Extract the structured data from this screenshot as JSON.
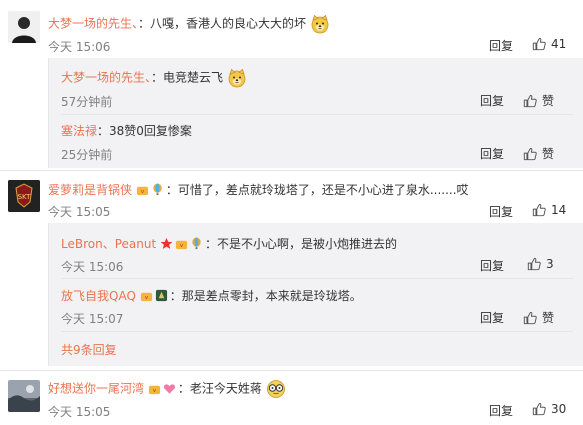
{
  "comments": [
    {
      "user": "大梦一场的先生、",
      "text": "：八嘎，香港人的良心大大的坏",
      "emoji": "dog-emoji",
      "time": "今天 15:06",
      "reply_label": "回复",
      "likes": "41",
      "replies": [
        {
          "user": "大梦一场的先生、",
          "text": "：电竞楚云飞",
          "emoji": "dog-emoji",
          "time": "57分钟前",
          "reply_label": "回复",
          "like_label": "赞"
        },
        {
          "user": "塞法禄",
          "text": "：38赞0回复惨案",
          "time": "25分钟前",
          "reply_label": "回复",
          "like_label": "赞"
        }
      ]
    },
    {
      "user": "爱萝莉是背锅侠",
      "text": "：可惜了，差点就玲珑塔了，还是不小心进了泉水.......哎",
      "time": "今天 15:05",
      "reply_label": "回复",
      "likes": "14",
      "replies": [
        {
          "user": "LeBron、Peanut",
          "text": "：不是不小心啊，是被小炮推进去的",
          "time": "今天 15:06",
          "reply_label": "回复",
          "likes": "3"
        },
        {
          "user": "放飞自我QAQ",
          "text": "：那是差点零封，本来就是玲珑塔。",
          "time": "今天 15:07",
          "reply_label": "回复",
          "like_label": "赞"
        }
      ],
      "see_all": "共9条回复"
    },
    {
      "user": "好想送你一尾河湾",
      "text": "：老汪今天姓蒋",
      "emoji": "glasses-emoji",
      "time": "今天 15:05",
      "reply_label": "回复",
      "likes": "30"
    }
  ],
  "colors": {
    "username": "#eb7350",
    "meta": "#808080",
    "reply_bg": "#f2f2f5"
  }
}
